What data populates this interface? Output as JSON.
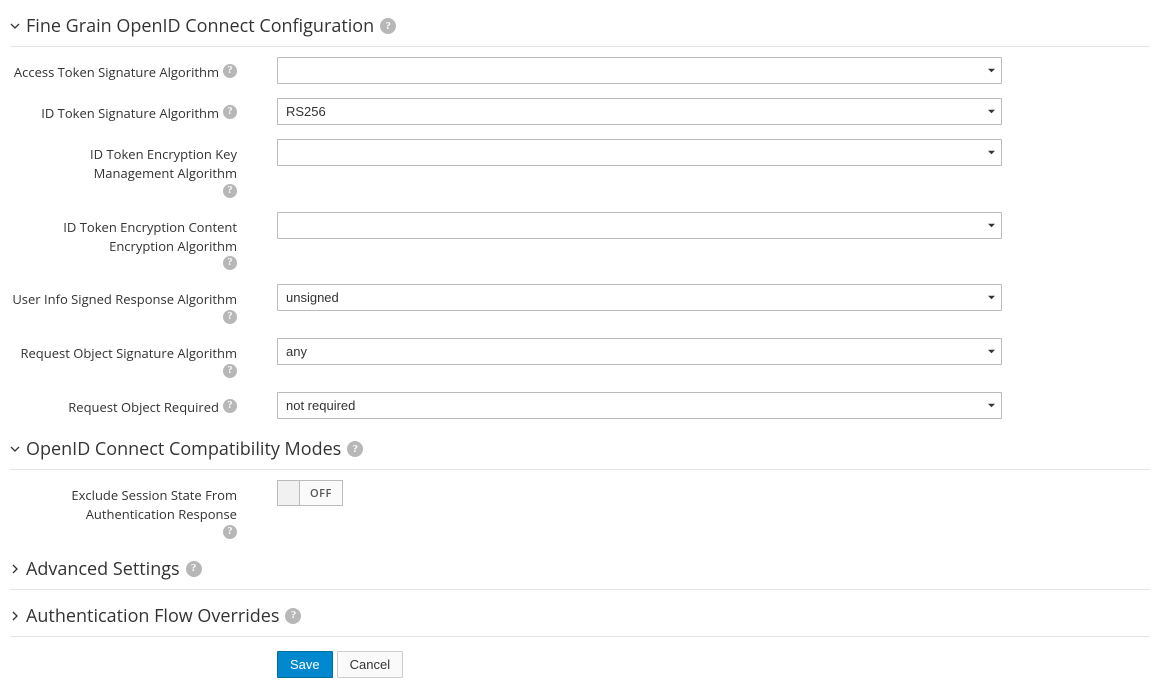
{
  "sections": {
    "fine_grain": {
      "title": "Fine Grain OpenID Connect Configuration",
      "expanded": true,
      "fields": {
        "access_token_sig": {
          "label": "Access Token Signature Algorithm",
          "value": ""
        },
        "id_token_sig": {
          "label": "ID Token Signature Algorithm",
          "value": "RS256"
        },
        "id_token_enc_key": {
          "label": "ID Token Encryption Key Management Algorithm",
          "value": ""
        },
        "id_token_enc_content": {
          "label": "ID Token Encryption Content Encryption Algorithm",
          "value": ""
        },
        "user_info_signed": {
          "label": "User Info Signed Response Algorithm",
          "value": "unsigned"
        },
        "request_obj_sig": {
          "label": "Request Object Signature Algorithm",
          "value": "any"
        },
        "request_obj_required": {
          "label": "Request Object Required",
          "value": "not required"
        }
      }
    },
    "compat_modes": {
      "title": "OpenID Connect Compatibility Modes",
      "expanded": true,
      "fields": {
        "exclude_session_state": {
          "label": "Exclude Session State From Authentication Response",
          "state": "OFF"
        }
      }
    },
    "advanced": {
      "title": "Advanced Settings",
      "expanded": false
    },
    "auth_flow": {
      "title": "Authentication Flow Overrides",
      "expanded": false
    }
  },
  "buttons": {
    "save": "Save",
    "cancel": "Cancel"
  },
  "help_glyph": "?"
}
